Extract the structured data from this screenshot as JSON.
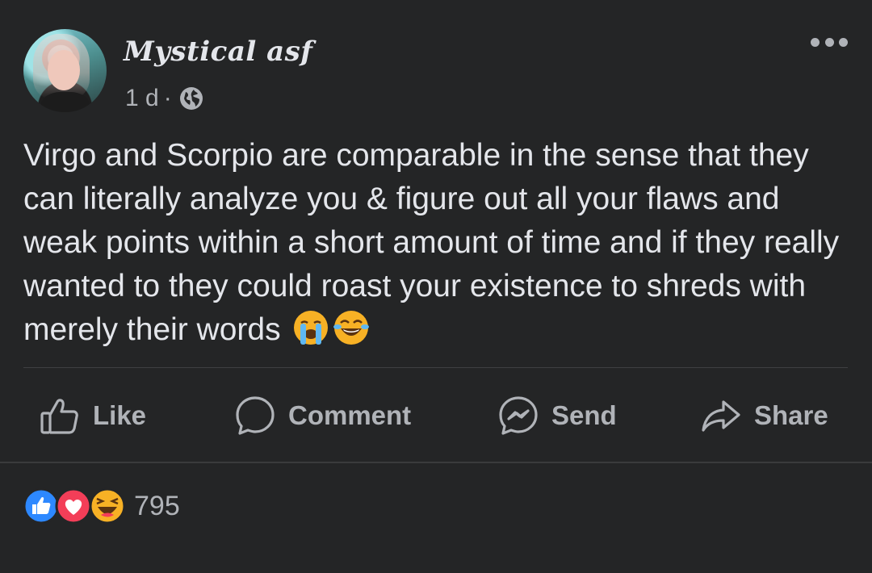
{
  "post": {
    "author_name": "Mystical asf",
    "timestamp": "1 d",
    "separator": "·",
    "privacy_icon": "globe-icon",
    "text": "Virgo and Scorpio are comparable in the sense that they can literally analyze you & figure out all your flaws and weak points within a short amount of time and if they really wanted to they could roast your existence to shreds with merely their words",
    "emojis": [
      "loudly-crying-face",
      "face-with-tears-of-joy"
    ]
  },
  "actions": {
    "like": "Like",
    "comment": "Comment",
    "send": "Send",
    "share": "Share"
  },
  "reactions": {
    "types": [
      "like",
      "love",
      "haha"
    ],
    "count": "795"
  },
  "colors": {
    "background": "#242526",
    "text_primary": "#e4e6eb",
    "text_secondary": "#b0b3b8",
    "like_blue": "#2d88ff",
    "love_red": "#f33e58",
    "haha_yellow": "#f7b125"
  }
}
